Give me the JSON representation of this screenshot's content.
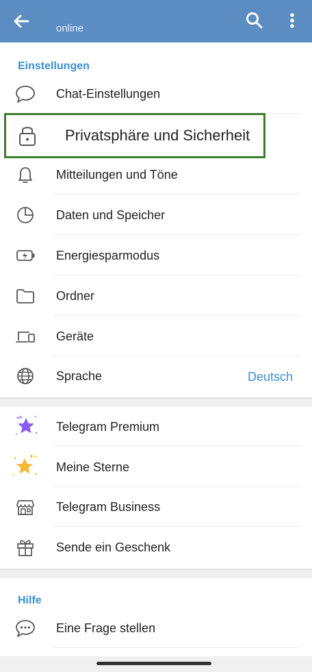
{
  "header": {
    "status": "online",
    "icons": [
      "back-arrow-icon",
      "search-icon",
      "more-vert-icon"
    ],
    "color": "#5b8cc2"
  },
  "sections": {
    "settings_title": "Einstellungen",
    "help_title": "Hilfe"
  },
  "settings_items": [
    {
      "label": "Chat-Einstellungen",
      "icon": "chat-bubble-icon"
    },
    {
      "label": "Privatsphäre und Sicherheit",
      "icon": "lock-icon",
      "highlighted": true
    },
    {
      "label": "Mitteilungen und Töne",
      "icon": "bell-icon"
    },
    {
      "label": "Daten und Speicher",
      "icon": "pie-chart-icon"
    },
    {
      "label": "Energiesparmodus",
      "icon": "battery-icon"
    },
    {
      "label": "Ordner",
      "icon": "folder-icon"
    },
    {
      "label": "Geräte",
      "icon": "devices-icon"
    },
    {
      "label": "Sprache",
      "icon": "globe-icon",
      "value": "Deutsch"
    }
  ],
  "premium_items": [
    {
      "label": "Telegram Premium",
      "icon": "premium-star-icon"
    },
    {
      "label": "Meine Sterne",
      "icon": "gold-star-icon"
    },
    {
      "label": "Telegram Business",
      "icon": "shop-icon"
    },
    {
      "label": "Sende ein Geschenk",
      "icon": "gift-icon"
    }
  ],
  "help_items": [
    {
      "label": "Eine Frage stellen",
      "icon": "question-chat-icon"
    }
  ],
  "colors": {
    "accent": "#3a8fd3",
    "highlight_border": "#3a7d2c"
  }
}
